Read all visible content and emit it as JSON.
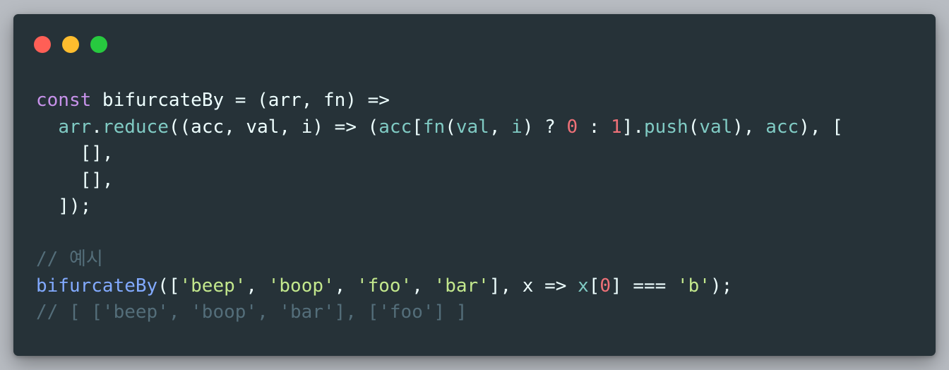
{
  "window": {
    "controls": {
      "close_color": "#ff5f56",
      "minimize_color": "#ffbd2e",
      "maximize_color": "#27c93f"
    }
  },
  "code": {
    "line1": [
      {
        "t": "k",
        "s": "const"
      },
      {
        "t": "p",
        "s": " bifurcateBy = (arr, fn) =>"
      }
    ],
    "line2": [
      {
        "t": "p",
        "s": "  "
      },
      {
        "t": "v",
        "s": "arr"
      },
      {
        "t": "p",
        "s": "."
      },
      {
        "t": "v",
        "s": "reduce"
      },
      {
        "t": "p",
        "s": "((acc, val, i) => ("
      },
      {
        "t": "v",
        "s": "acc"
      },
      {
        "t": "p",
        "s": "["
      },
      {
        "t": "v",
        "s": "fn"
      },
      {
        "t": "p",
        "s": "("
      },
      {
        "t": "v",
        "s": "val"
      },
      {
        "t": "p",
        "s": ", "
      },
      {
        "t": "v",
        "s": "i"
      },
      {
        "t": "p",
        "s": ") ? "
      },
      {
        "t": "n",
        "s": "0"
      },
      {
        "t": "p",
        "s": " : "
      },
      {
        "t": "n",
        "s": "1"
      },
      {
        "t": "p",
        "s": "]."
      },
      {
        "t": "v",
        "s": "push"
      },
      {
        "t": "p",
        "s": "("
      },
      {
        "t": "v",
        "s": "val"
      },
      {
        "t": "p",
        "s": "), "
      },
      {
        "t": "v",
        "s": "acc"
      },
      {
        "t": "p",
        "s": "), ["
      }
    ],
    "line3": [
      {
        "t": "p",
        "s": "    [],"
      }
    ],
    "line4": [
      {
        "t": "p",
        "s": "    [],"
      }
    ],
    "line5": [
      {
        "t": "p",
        "s": "  ]);"
      }
    ],
    "line6": [
      {
        "t": "p",
        "s": ""
      }
    ],
    "line7": [
      {
        "t": "c",
        "s": "// 예시"
      }
    ],
    "line8": [
      {
        "t": "m",
        "s": "bifurcateBy"
      },
      {
        "t": "p",
        "s": "(["
      },
      {
        "t": "s",
        "s": "'beep'"
      },
      {
        "t": "p",
        "s": ", "
      },
      {
        "t": "s",
        "s": "'boop'"
      },
      {
        "t": "p",
        "s": ", "
      },
      {
        "t": "s",
        "s": "'foo'"
      },
      {
        "t": "p",
        "s": ", "
      },
      {
        "t": "s",
        "s": "'bar'"
      },
      {
        "t": "p",
        "s": "], x => "
      },
      {
        "t": "v",
        "s": "x"
      },
      {
        "t": "p",
        "s": "["
      },
      {
        "t": "n",
        "s": "0"
      },
      {
        "t": "p",
        "s": "] === "
      },
      {
        "t": "s",
        "s": "'b'"
      },
      {
        "t": "p",
        "s": ");"
      }
    ],
    "line9": [
      {
        "t": "c",
        "s": "// [ ['beep', 'boop', 'bar'], ['foo'] ]"
      }
    ]
  },
  "colors": {
    "background": "#263238",
    "keyword": "#c792ea",
    "plain": "#eeffff",
    "variable": "#80cbc4",
    "function": "#82aaff",
    "number": "#f07178",
    "string": "#c3e88d",
    "comment": "#546e7a"
  }
}
